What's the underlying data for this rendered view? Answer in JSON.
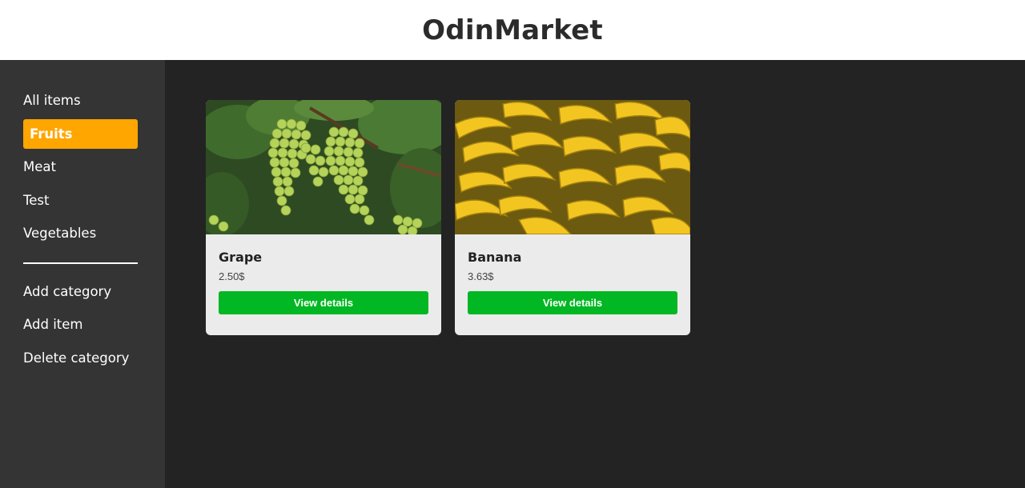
{
  "header": {
    "title": "OdinMarket"
  },
  "sidebar": {
    "categories": [
      {
        "label": "All items",
        "active": false
      },
      {
        "label": "Fruits",
        "active": true
      },
      {
        "label": "Meat",
        "active": false
      },
      {
        "label": "Test",
        "active": false
      },
      {
        "label": "Vegetables",
        "active": false
      }
    ],
    "actions": [
      {
        "label": "Add category"
      },
      {
        "label": "Add item"
      },
      {
        "label": "Delete category"
      }
    ]
  },
  "items": [
    {
      "name": "Grape",
      "price": "2.50$",
      "button_label": "View details",
      "photo": "grape-photo"
    },
    {
      "name": "Banana",
      "price": "3.63$",
      "button_label": "View details",
      "photo": "banana-photo"
    }
  ],
  "colors": {
    "accent": "#ffa600",
    "button": "#01b723",
    "sidebar_bg": "#343434",
    "content_bg": "#232323",
    "card_bg": "#ebebeb"
  }
}
